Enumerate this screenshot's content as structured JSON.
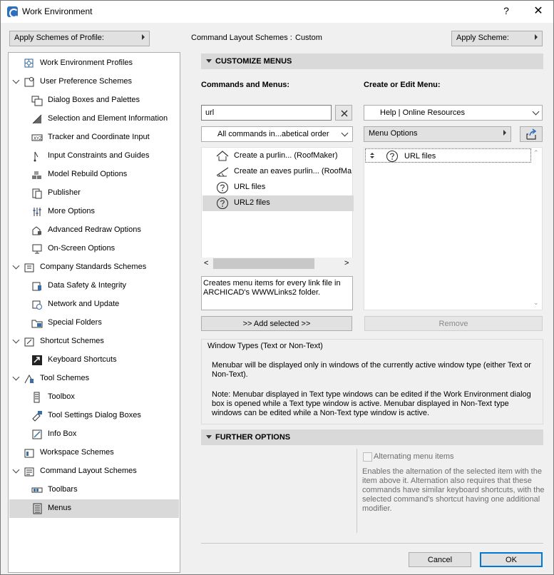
{
  "window": {
    "title": "Work Environment",
    "help_glyph": "?",
    "close_glyph": "✕"
  },
  "profile": {
    "apply_label": "Apply Schemes of Profile:"
  },
  "header": {
    "command_layout_label": "Command Layout Schemes :",
    "command_layout_value": "Custom",
    "apply_scheme_label": "Apply Scheme:"
  },
  "tree": {
    "items": [
      {
        "label": "Work Environment Profiles",
        "icon": "profiles-icon"
      },
      {
        "label": "User Preference Schemes",
        "icon": "user-pref-icon"
      },
      {
        "label": "Dialog Boxes and Palettes",
        "icon": "dialog-icon"
      },
      {
        "label": "Selection and Element Information",
        "icon": "selection-icon"
      },
      {
        "label": "Tracker and Coordinate Input",
        "icon": "tracker-icon"
      },
      {
        "label": "Input Constraints and Guides",
        "icon": "constraints-icon"
      },
      {
        "label": "Model Rebuild Options",
        "icon": "rebuild-icon"
      },
      {
        "label": "Publisher",
        "icon": "publisher-icon"
      },
      {
        "label": "More Options",
        "icon": "sliders-icon"
      },
      {
        "label": "Advanced Redraw Options",
        "icon": "redraw-icon"
      },
      {
        "label": "On-Screen Options",
        "icon": "monitor-icon"
      },
      {
        "label": "Company Standards Schemes",
        "icon": "company-icon"
      },
      {
        "label": "Data Safety & Integrity",
        "icon": "safety-icon"
      },
      {
        "label": "Network and Update",
        "icon": "network-icon"
      },
      {
        "label": "Special Folders",
        "icon": "folder-icon"
      },
      {
        "label": "Shortcut Schemes",
        "icon": "shortcut-icon"
      },
      {
        "label": "Keyboard Shortcuts",
        "icon": "keyboard-icon"
      },
      {
        "label": "Tool Schemes",
        "icon": "tool-icon"
      },
      {
        "label": "Toolbox",
        "icon": "toolbox-icon"
      },
      {
        "label": "Tool Settings Dialog Boxes",
        "icon": "tool-settings-icon"
      },
      {
        "label": "Info Box",
        "icon": "infobox-icon"
      },
      {
        "label": "Workspace Schemes",
        "icon": "workspace-icon"
      },
      {
        "label": "Command Layout Schemes",
        "icon": "command-layout-icon"
      },
      {
        "label": "Toolbars",
        "icon": "toolbars-icon"
      },
      {
        "label": "Menus",
        "icon": "menus-icon"
      }
    ]
  },
  "customize": {
    "section_title": "CUSTOMIZE MENUS",
    "commands_label": "Commands and Menus:",
    "edit_label": "Create or Edit Menu:",
    "search_value": "url",
    "filter_value": "All commands in...abetical order",
    "menu_value": "Help | Online Resources",
    "menu_options_label": "Menu Options",
    "commands": [
      {
        "label": "Create a purlin... (RoofMaker)",
        "icon": "roof-icon"
      },
      {
        "label": "Create an eaves purlin... (RoofMa",
        "icon": "eaves-icon"
      },
      {
        "label": "URL files",
        "icon": "help-icon"
      },
      {
        "label": "URL2 files",
        "icon": "help-icon"
      }
    ],
    "menu_items": [
      {
        "label": "URL files",
        "icon": "help-icon"
      }
    ],
    "description": "Creates menu items for every link file in ARCHICAD's WWWLinks2 folder.",
    "add_button": ">> Add selected >>",
    "remove_button": "Remove"
  },
  "window_types": {
    "group_title": "Window Types (Text or Non-Text)",
    "para1": "Menubar will be displayed only in windows of the currently active window type (either Text or Non-Text).",
    "para2": "Note: Menubar displayed in Text type windows can be edited if the Work Environment dialog box is opened while a Text type window is active. Menubar displayed in Non-Text type windows can be edited while a Non-Text type window is active."
  },
  "further": {
    "section_title": "FURTHER OPTIONS",
    "alternating_label": "Alternating menu items",
    "alternating_desc": "Enables the alternation of the selected item with the item above it. Alternation also requires that these commands have similar keyboard shortcuts, with the selected command's shortcut having one additional modifier."
  },
  "footer": {
    "cancel_label": "Cancel",
    "ok_label": "OK"
  },
  "colors": {
    "selection": "#d9d9d9",
    "accent_border": "#0078d7",
    "section_bg": "#d9d9d9"
  }
}
